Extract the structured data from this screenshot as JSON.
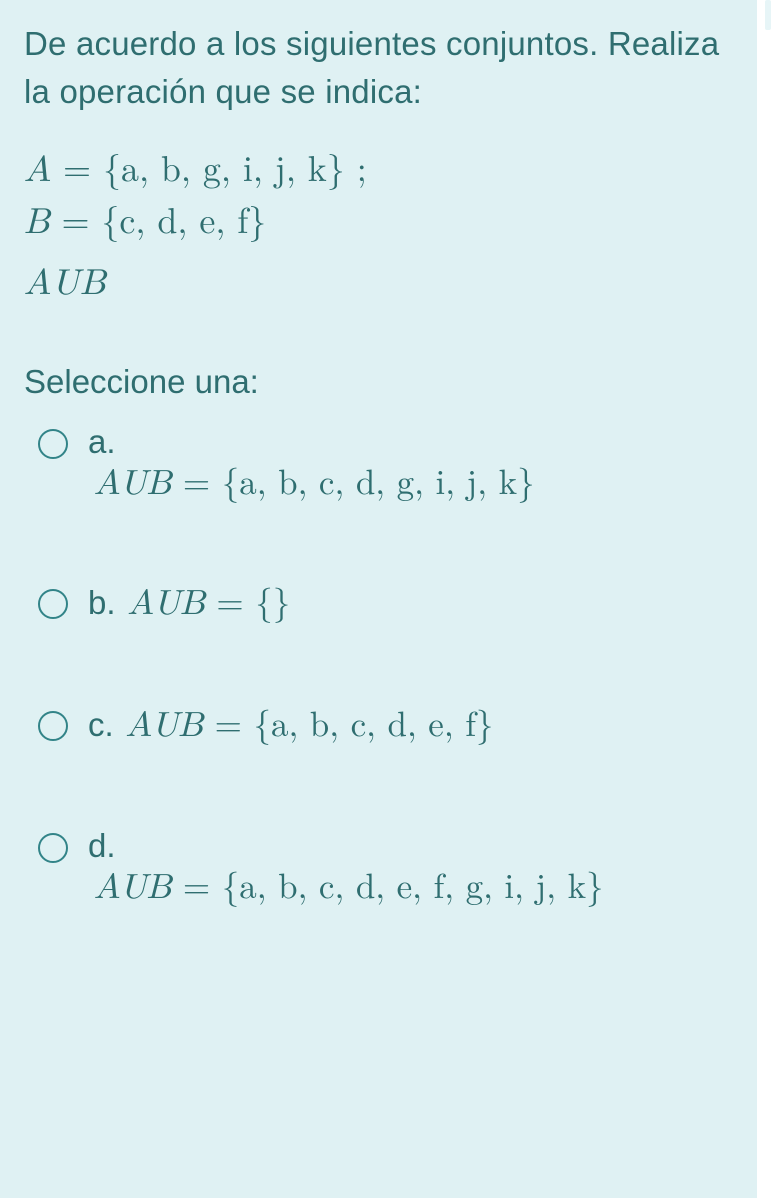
{
  "question": {
    "stem": "De acuerdo a los siguientes conjuntos. Realiza la operación que se indica:",
    "setA_lhs": "A",
    "eq": " = ",
    "setA_rhs": "{a, b, g, i, j, k} ;",
    "setB_lhs": "B",
    "setB_rhs": "{c, d, e, f}",
    "operation": "AUB",
    "select_label": "Seleccione una:"
  },
  "options": {
    "a": {
      "letter": "a.",
      "lhs": "AUB",
      "eq": " = ",
      "rhs": "{a, b, c, d, g, i, j, k}"
    },
    "b": {
      "letter": "b.",
      "lhs": "AUB",
      "eq": " = ",
      "rhs": "{}"
    },
    "c": {
      "letter": "c.",
      "lhs": "AUB",
      "eq": " = ",
      "rhs": "{a, b, c, d, e, f}"
    },
    "d": {
      "letter": "d.",
      "lhs": "AUB",
      "eq": " = ",
      "rhs": "{a, b, c, d, e, f, g, i, j, k}"
    }
  }
}
